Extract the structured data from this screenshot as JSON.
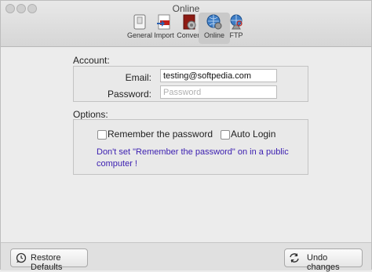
{
  "window": {
    "title": "Online"
  },
  "tabs": [
    {
      "label": "General"
    },
    {
      "label": "Import"
    },
    {
      "label": "Convert"
    },
    {
      "label": "Online",
      "selected": true
    },
    {
      "label": "FTP"
    }
  ],
  "account": {
    "section_label": "Account:",
    "email_label": "Email:",
    "email_value": "testing@softpedia.com",
    "password_label": "Password:",
    "password_placeholder": "Password"
  },
  "options": {
    "section_label": "Options:",
    "remember_label": "Remember the password",
    "remember_checked": false,
    "autologin_label": "Auto Login",
    "autologin_checked": false,
    "warning_line1": "Don't set \"Remember the password\" on in a public",
    "warning_line2": "computer !"
  },
  "footer": {
    "restore_label": "Restore Defaults",
    "undo_label": "Undo changes"
  },
  "colors": {
    "warning_text": "#3a1db0",
    "selected_tab": "#c9c9c9"
  }
}
